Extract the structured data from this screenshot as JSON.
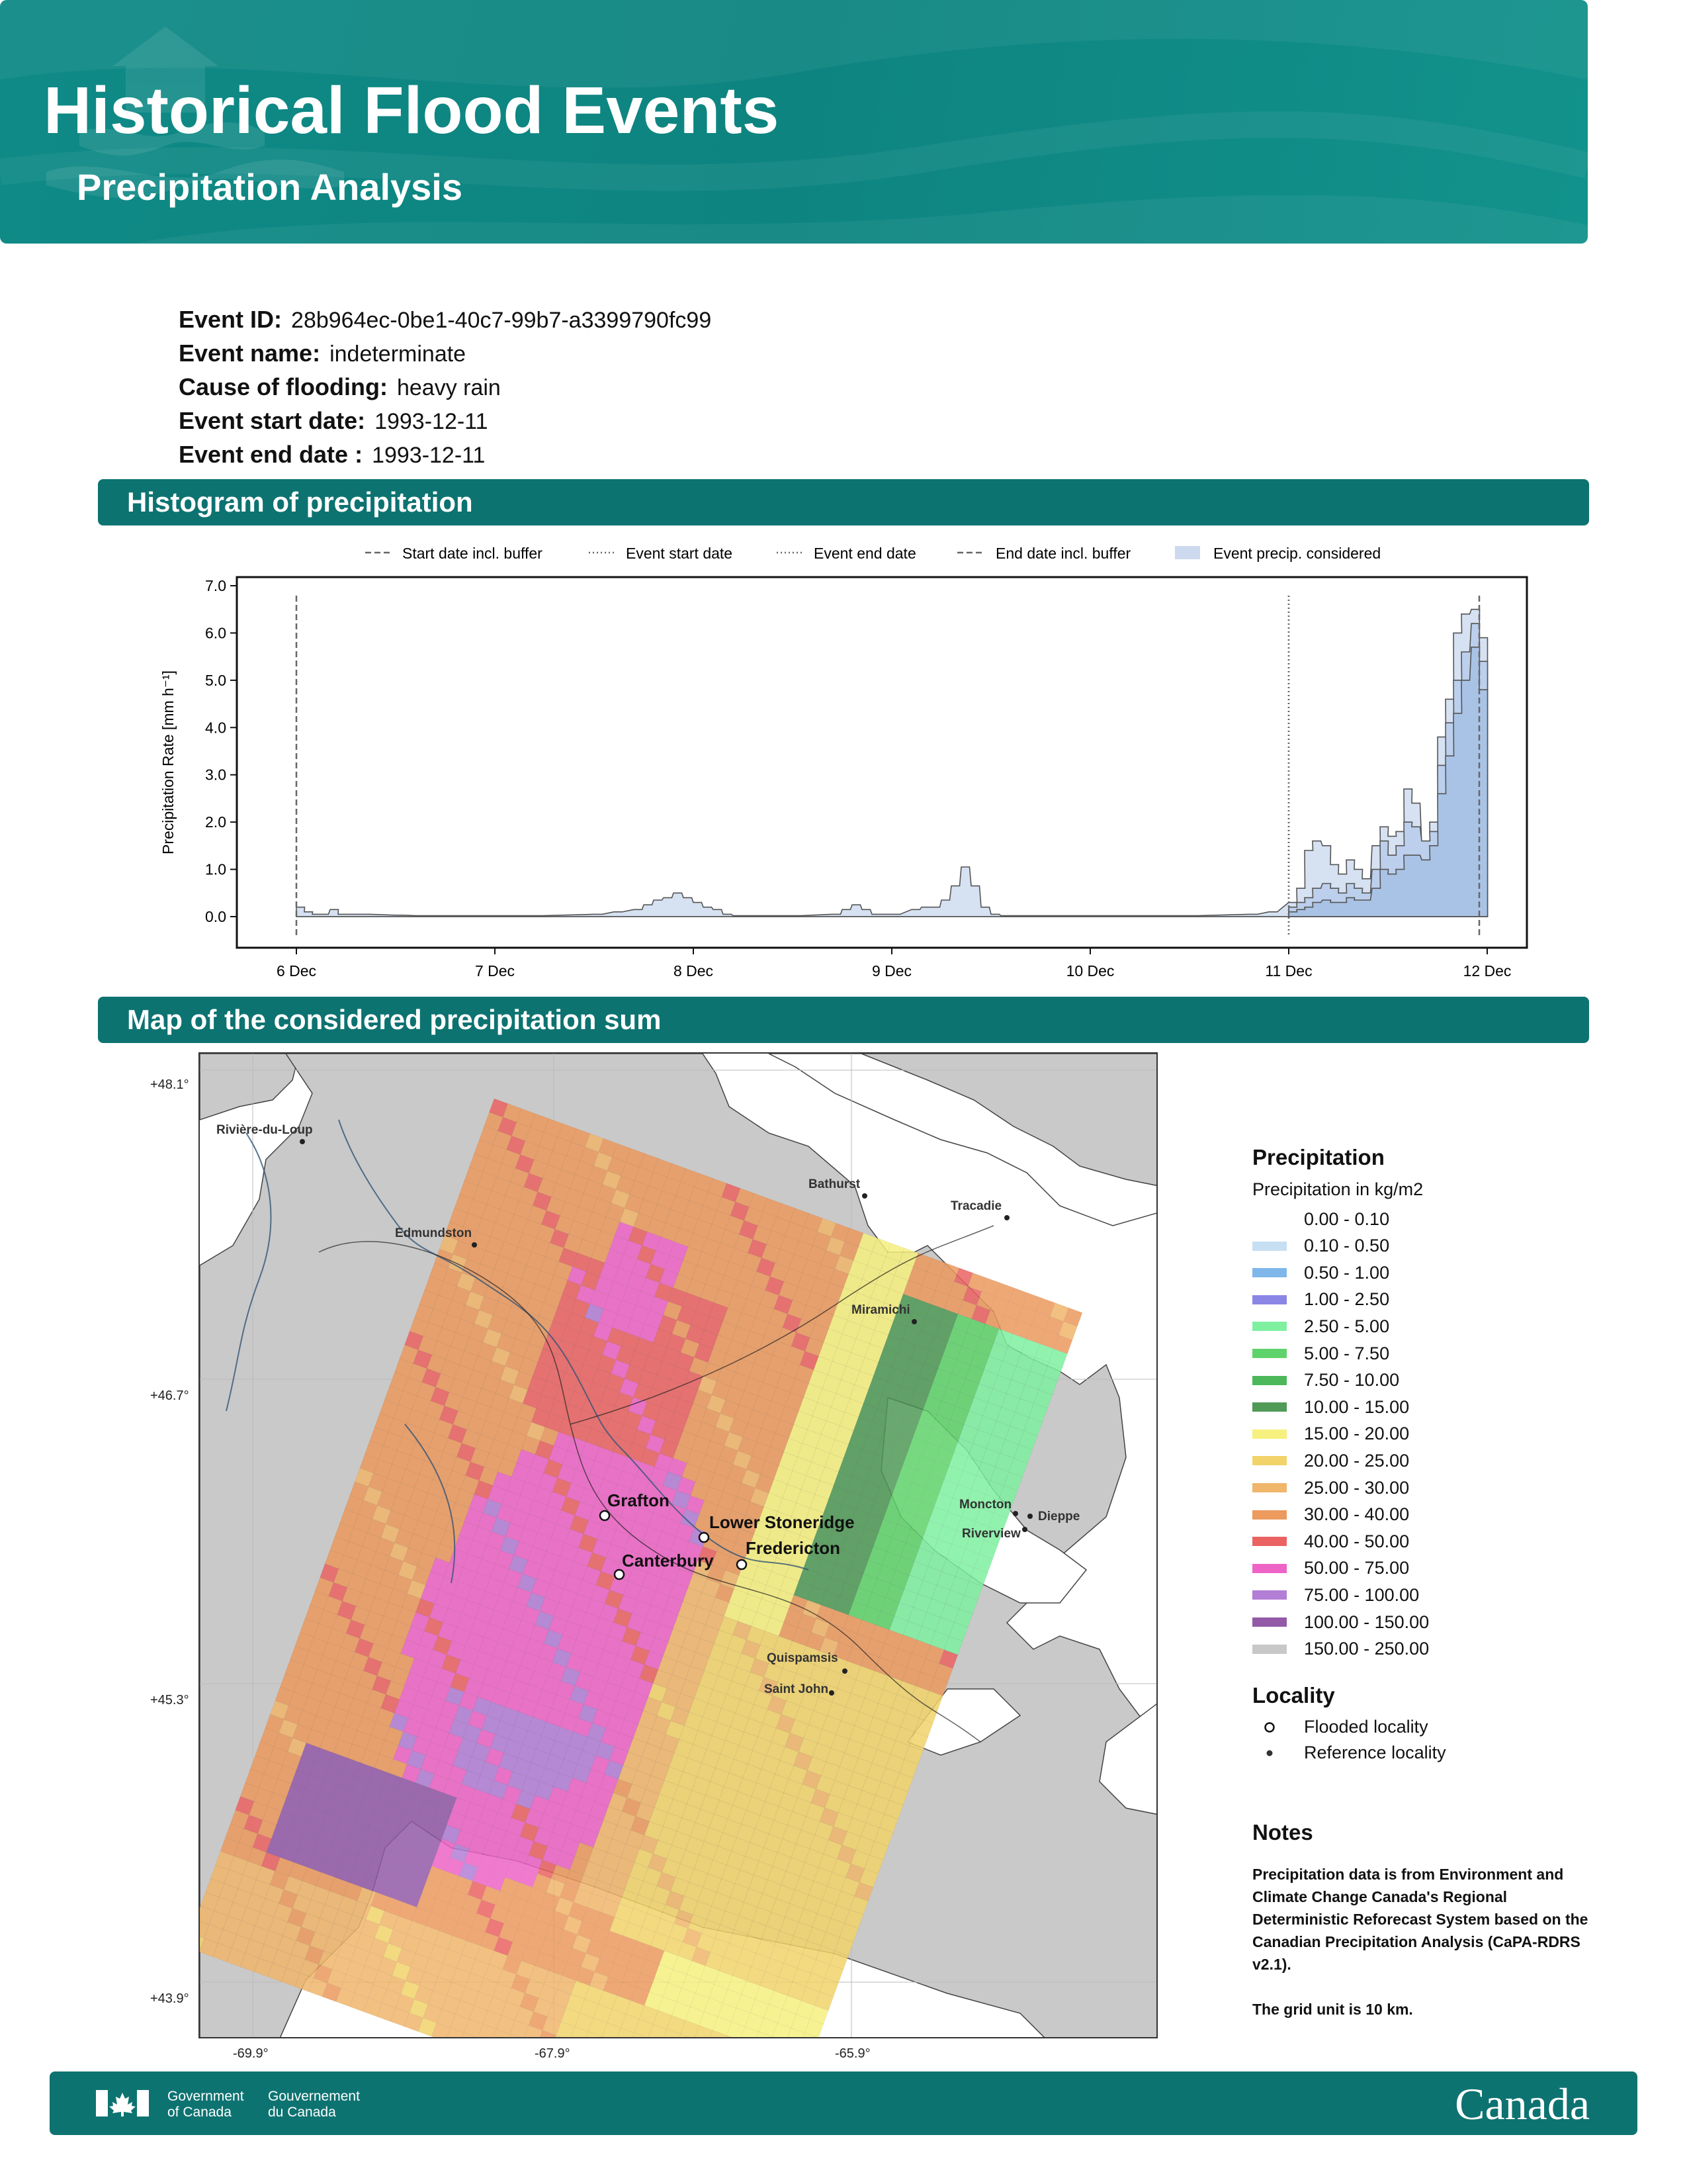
{
  "header": {
    "title": "Historical Flood Events",
    "subtitle": "Precipitation Analysis"
  },
  "event": {
    "id_label": "Event ID:",
    "id_value": "28b964ec-0be1-40c7-99b7-a3399790fc99",
    "name_label": "Event name:",
    "name_value": "indeterminate",
    "cause_label": "Cause of flooding:",
    "cause_value": "heavy rain",
    "start_label": "Event start date:",
    "start_value": "1993-12-11",
    "end_label": "Event end date :",
    "end_value": "1993-12-11"
  },
  "sections": {
    "histogram_title": "Histogram of precipitation",
    "map_title": "Map of the considered precipitation sum"
  },
  "chart_data": {
    "type": "area",
    "ylabel": "Precipitation Rate [mm h⁻¹]",
    "ylim": [
      0,
      7.2
    ],
    "yticks": [
      "0.0",
      "1.0",
      "2.0",
      "3.0",
      "4.0",
      "5.0",
      "6.0",
      "7.0"
    ],
    "xticks": [
      "6 Dec",
      "7 Dec",
      "8 Dec",
      "9 Dec",
      "10 Dec",
      "11 Dec",
      "12 Dec"
    ],
    "xlim_days": [
      5.7,
      12.2
    ],
    "legend": {
      "start_buffer": "Start date incl. buffer",
      "event_start": "Event start date",
      "event_end": "Event end date",
      "end_buffer": "End date incl. buffer",
      "considered": "Event precip. considered"
    },
    "vlines": {
      "start_buffer": 6.0,
      "event_start": 11.0,
      "event_end": 11.0,
      "end_buffer": 11.96
    },
    "series": [
      {
        "x": [
          6.0,
          6.04,
          6.08,
          6.12,
          6.17,
          6.21,
          6.25,
          6.29,
          6.33,
          6.5,
          6.6,
          7.2,
          7.5,
          7.6,
          7.7,
          7.75,
          7.8,
          7.85,
          7.9,
          7.95,
          8.0,
          8.05,
          8.1,
          8.15,
          8.2,
          8.5,
          8.7,
          8.75,
          8.8,
          8.85,
          8.9,
          9.0,
          9.1,
          9.15,
          9.2,
          9.25,
          9.3,
          9.35,
          9.4,
          9.45,
          9.5,
          9.55,
          9.6,
          10.5,
          10.8,
          10.9,
          11.0,
          11.04,
          11.08,
          11.12,
          11.17,
          11.21,
          11.25,
          11.29,
          11.33,
          11.37,
          11.42,
          11.46,
          11.5,
          11.54,
          11.58,
          11.62,
          11.67,
          11.71,
          11.75,
          11.79,
          11.83,
          11.87,
          11.92,
          11.96
        ],
        "y": [
          0.2,
          0.1,
          0.05,
          0.05,
          0.15,
          0.05,
          0.05,
          0.05,
          0.05,
          0.03,
          0.02,
          0.02,
          0.05,
          0.1,
          0.15,
          0.25,
          0.35,
          0.4,
          0.5,
          0.4,
          0.3,
          0.2,
          0.15,
          0.05,
          0.02,
          0.02,
          0.05,
          0.15,
          0.25,
          0.15,
          0.05,
          0.05,
          0.15,
          0.2,
          0.2,
          0.35,
          0.65,
          1.05,
          0.65,
          0.2,
          0.05,
          0.02,
          0.02,
          0.02,
          0.05,
          0.1,
          0.3,
          0.6,
          1.4,
          1.6,
          1.5,
          1.1,
          0.9,
          1.2,
          1.0,
          0.8,
          1.5,
          1.9,
          1.7,
          1.8,
          2.7,
          2.4,
          1.5,
          2.0,
          3.8,
          4.6,
          6.0,
          6.4,
          6.5,
          5.9
        ]
      },
      {
        "x": [
          11.0,
          11.04,
          11.08,
          11.12,
          11.17,
          11.21,
          11.25,
          11.29,
          11.33,
          11.37,
          11.42,
          11.46,
          11.5,
          11.54,
          11.58,
          11.62,
          11.67,
          11.71,
          11.75,
          11.79,
          11.83,
          11.87,
          11.92,
          11.96
        ],
        "y": [
          0.2,
          0.3,
          0.4,
          0.6,
          0.7,
          0.6,
          0.5,
          0.7,
          0.6,
          0.5,
          1.0,
          1.6,
          1.3,
          1.5,
          2.0,
          1.9,
          1.6,
          1.8,
          3.2,
          4.1,
          5.0,
          5.6,
          6.2,
          5.4
        ]
      },
      {
        "x": [
          11.0,
          11.04,
          11.08,
          11.12,
          11.17,
          11.21,
          11.25,
          11.29,
          11.33,
          11.37,
          11.42,
          11.46,
          11.5,
          11.54,
          11.58,
          11.62,
          11.67,
          11.71,
          11.75,
          11.79,
          11.83,
          11.87,
          11.92,
          11.96
        ],
        "y": [
          0.1,
          0.15,
          0.2,
          0.3,
          0.35,
          0.3,
          0.3,
          0.4,
          0.35,
          0.35,
          0.6,
          1.0,
          0.9,
          1.0,
          1.3,
          1.3,
          1.2,
          1.5,
          2.6,
          3.4,
          4.3,
          5.0,
          5.7,
          4.8
        ]
      }
    ]
  },
  "map": {
    "lat_labels": [
      "+48.1°",
      "+46.7°",
      "+45.3°",
      "+43.9°"
    ],
    "lon_labels": [
      "-69.9°",
      "-67.9°",
      "-65.9°"
    ],
    "reference_places": [
      "Rivière-du-Loup",
      "Edmundston",
      "Bathurst",
      "Tracadie",
      "Miramichi",
      "Moncton",
      "Dieppe",
      "Riverview",
      "Quispamsis",
      "Saint John"
    ],
    "flooded_places": [
      "Grafton",
      "Lower Stoneridge",
      "Fredericton",
      "Canterbury"
    ]
  },
  "legend": {
    "precip_title": "Precipitation",
    "precip_sub": "Precipitation in kg/m2",
    "classes": [
      {
        "label": "0.00 - 0.10",
        "color": "#ffffff"
      },
      {
        "label": "0.10 - 0.50",
        "color": "#c6dff2"
      },
      {
        "label": "0.50 - 1.00",
        "color": "#7fb7ea"
      },
      {
        "label": "1.00 - 2.50",
        "color": "#8b86e6"
      },
      {
        "label": "2.50 - 5.00",
        "color": "#7ef0a0"
      },
      {
        "label": "5.00 - 7.50",
        "color": "#5fd36b"
      },
      {
        "label": "7.50 - 10.00",
        "color": "#4cb85a"
      },
      {
        "label": "10.00 - 15.00",
        "color": "#4f9a57"
      },
      {
        "label": "15.00 - 20.00",
        "color": "#f6f07e"
      },
      {
        "label": "20.00 - 25.00",
        "color": "#f1d36a"
      },
      {
        "label": "25.00 - 30.00",
        "color": "#f0b66c"
      },
      {
        "label": "30.00 - 40.00",
        "color": "#ec9a5e"
      },
      {
        "label": "40.00 - 50.00",
        "color": "#eb6262"
      },
      {
        "label": "50.00 - 75.00",
        "color": "#ee64c6"
      },
      {
        "label": "75.00 - 100.00",
        "color": "#b27ed6"
      },
      {
        "label": "100.00 - 150.00",
        "color": "#935aa8"
      },
      {
        "label": "150.00 - 250.00",
        "color": "#c8c8c8"
      }
    ],
    "locality_title": "Locality",
    "flooded": "Flooded locality",
    "reference": "Reference locality"
  },
  "notes": {
    "title": "Notes",
    "text1": "Precipitation data is from Environment and Climate Change Canada's Regional Deterministic Reforecast System based on the Canadian Precipitation Analysis (CaPA-RDRS v2.1).",
    "text2": "The grid unit is 10 km."
  },
  "footer": {
    "gov_en_1": "Government",
    "gov_en_2": "of Canada",
    "gov_fr_1": "Gouvernement",
    "gov_fr_2": "du Canada",
    "canada": "Canada"
  },
  "colors": {
    "brand": "#0d7371",
    "header": "#0f8a86",
    "considered": "#a9c3e6"
  }
}
